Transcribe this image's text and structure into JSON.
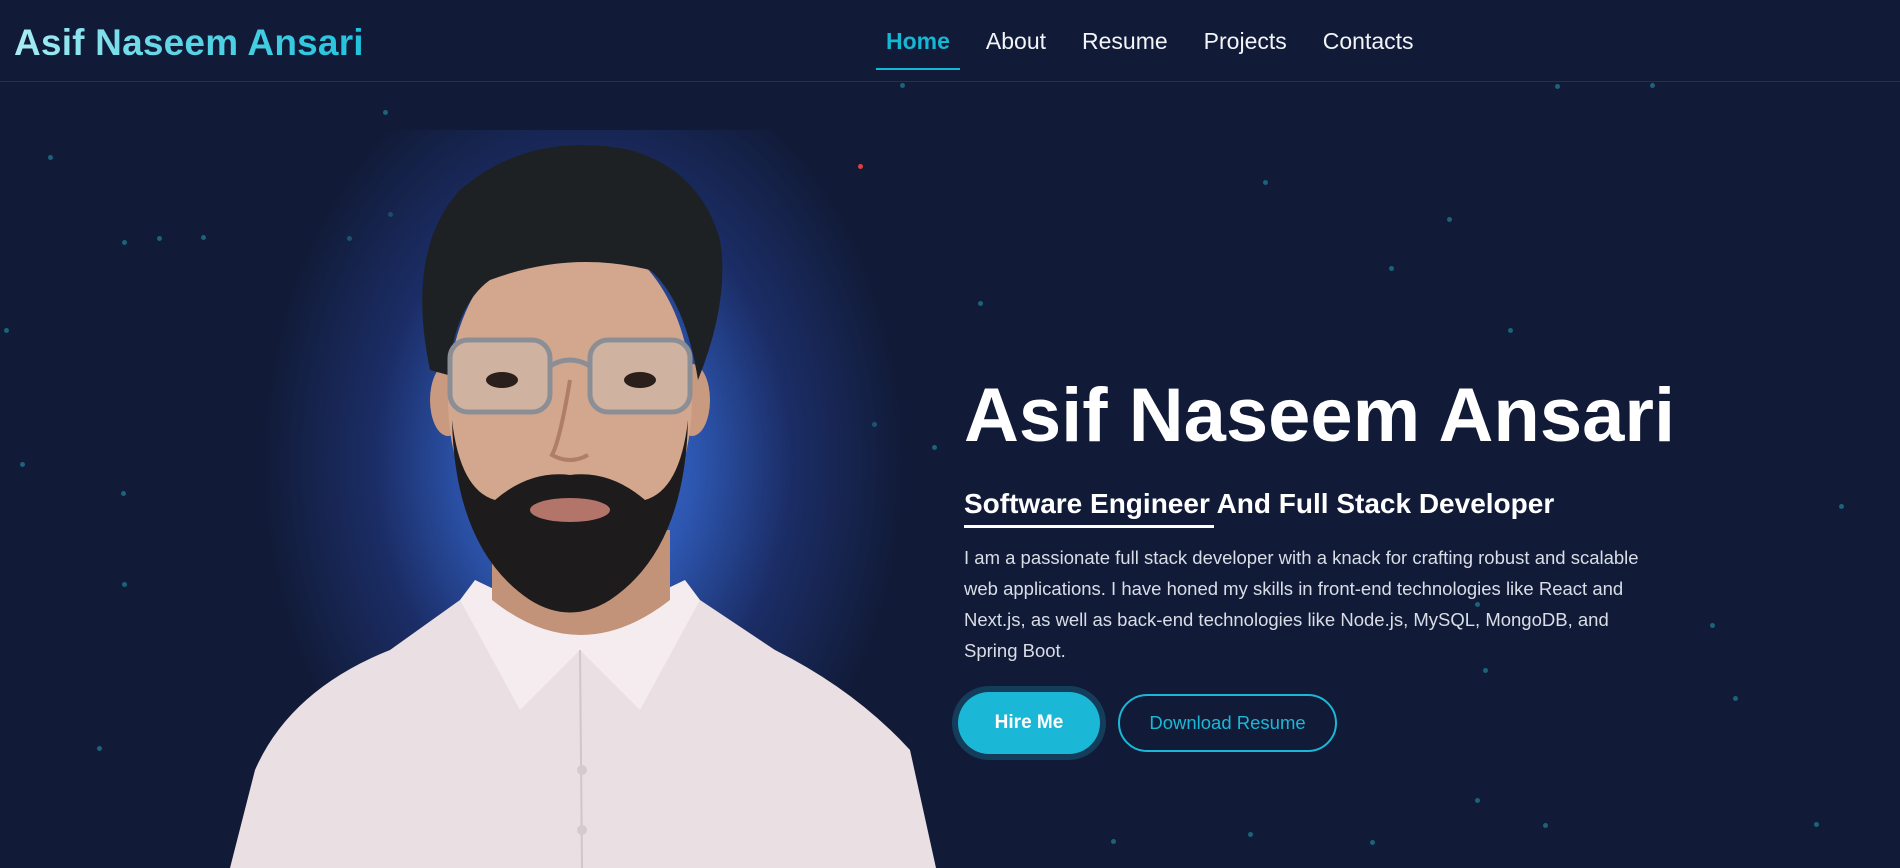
{
  "header": {
    "logo": "Asif Naseem Ansari",
    "nav": [
      {
        "label": "Home",
        "active": true
      },
      {
        "label": "About",
        "active": false
      },
      {
        "label": "Resume",
        "active": false
      },
      {
        "label": "Projects",
        "active": false
      },
      {
        "label": "Contacts",
        "active": false
      }
    ]
  },
  "hero": {
    "name": "Asif Naseem Ansari",
    "role": "Software Engineer And Full Stack Developer",
    "description": "I am a passionate full stack developer with a knack for crafting robust and scalable web applications. I have honed my skills in front-end technologies like React and Next.js, as well as back-end technologies like Node.js, MySQL, MongoDB, and Spring Boot.",
    "primary_button": "Hire Me",
    "secondary_button": "Download Resume"
  },
  "colors": {
    "background": "#111b38",
    "accent": "#1ab8d6",
    "portrait_glow": "#3b74d6"
  }
}
